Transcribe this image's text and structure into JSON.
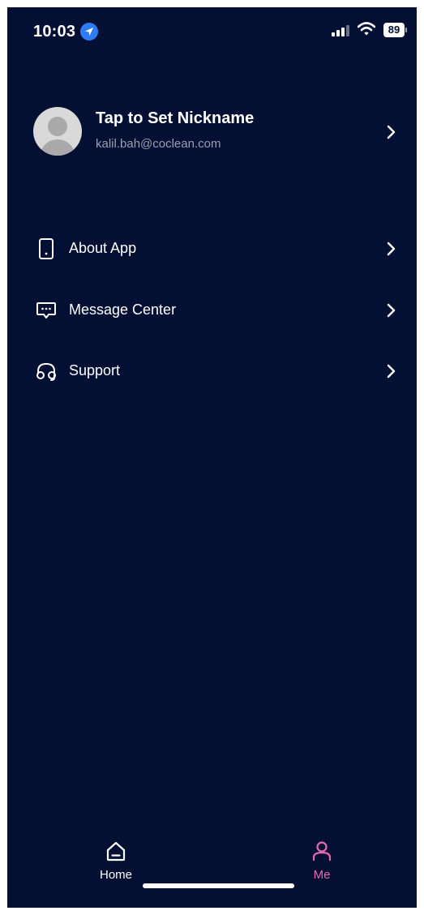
{
  "status_bar": {
    "time": "10:03",
    "battery": "89"
  },
  "profile": {
    "nickname": "Tap to Set Nickname",
    "email": "kalil.bah@coclean.com"
  },
  "menu": {
    "items": [
      {
        "label": "About App",
        "icon": "phone-icon"
      },
      {
        "label": "Message Center",
        "icon": "message-icon"
      },
      {
        "label": "Support",
        "icon": "headset-icon"
      }
    ]
  },
  "tab_bar": {
    "tabs": [
      {
        "label": "Home",
        "icon": "home-icon",
        "active": false
      },
      {
        "label": "Me",
        "icon": "person-icon",
        "active": true
      }
    ]
  },
  "colors": {
    "background": "#031033",
    "accent": "#e66ab2",
    "text": "#ffffff",
    "muted": "#9aa0b3"
  }
}
